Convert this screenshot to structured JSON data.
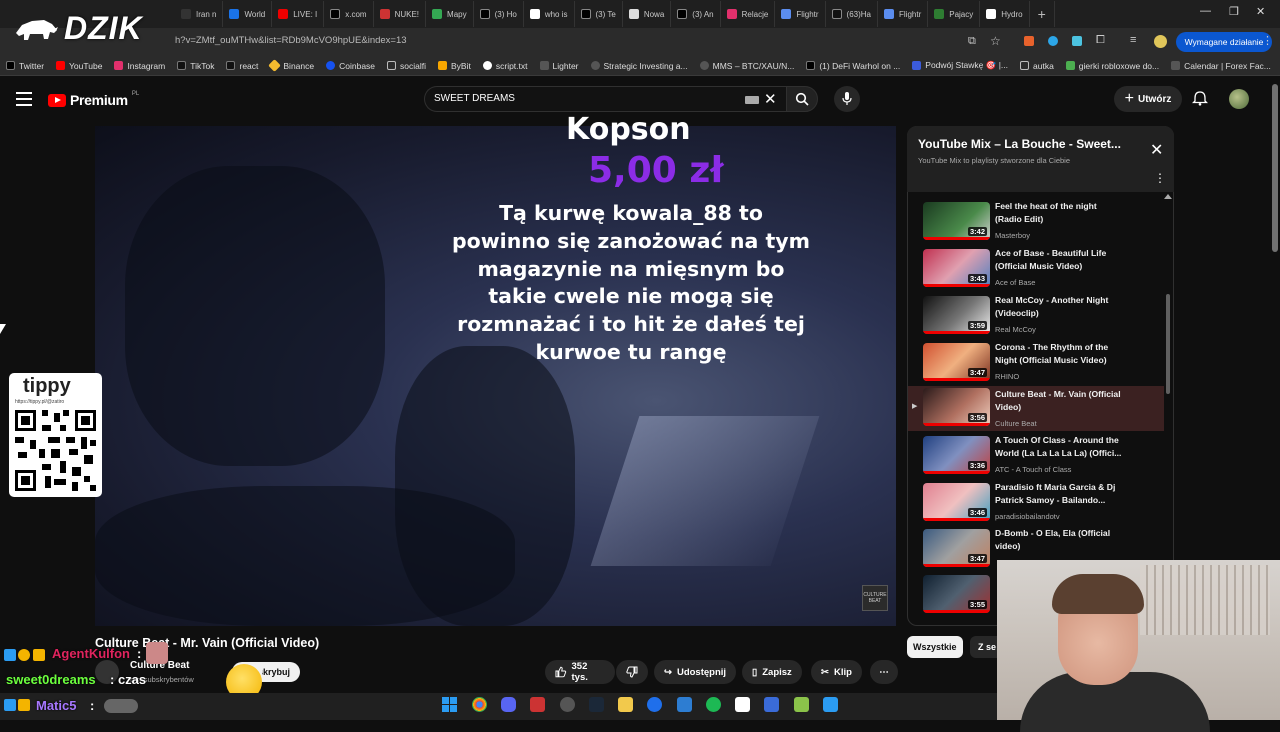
{
  "browser": {
    "tabs": [
      "Iran n",
      "World",
      "LIVE: I",
      "x.com",
      "NUKE!",
      "Mapy",
      "(3) Ho",
      "who is",
      "(3) Te",
      "Nowa",
      "(3) An",
      "Relacje",
      "Flightr",
      "(63)Ha",
      "Flightr",
      "Pajacy",
      "Hydro"
    ],
    "url": "h?v=ZMtf_ouMTHw&list=RDb9McVO9hpUE&index=13",
    "required_action": "Wymagane działanie",
    "bookmarks": [
      "Twitter",
      "YouTube",
      "Instagram",
      "TikTok",
      "react",
      "Binance",
      "Coinbase",
      "socialfi",
      "ByBit",
      "script.txt",
      "Lighter",
      "Strategic Investing a...",
      "MMS – BTC/XAU/N...",
      "(1) DeFi Warhol on ...",
      "Podwój Stawkę 🎯 |...",
      "autka",
      "gierki robloxowe do...",
      "Calendar | Forex Fac..."
    ]
  },
  "overlay": {
    "logo": "DZIK",
    "donation": {
      "name": "Kopson",
      "amount": "5,00 zł",
      "message": "Tą kurwę kowala_88 to powinno się zanożować na tym magazynie na mięsnym bo takie cwele nie mogą się rozmnażać i to hit że dałeś tej kurwoe tu rangę"
    },
    "tippy": {
      "title": "tippy",
      "url": "https://tippy.pl/@zatiro"
    },
    "chat": [
      {
        "name": "AgentKulfon",
        "text": ":",
        "color": "#e0245e"
      },
      {
        "name": "sweet0dreams",
        "text": ": czas",
        "color": "#6cff3e"
      },
      {
        "name": "Matic5",
        "text": ":",
        "color": "#a777ff"
      }
    ],
    "emote_count": "15"
  },
  "youtube": {
    "brand": "Premium",
    "country": "PL",
    "search_query": "SWEET DREAMS",
    "create_label": "Utwórz",
    "video": {
      "title": "Culture Beat - Mr. Vain (Official Video)",
      "channel": "Culture Beat",
      "subs": "tys. subskrybentów",
      "subscribe": "Subskrybuj",
      "likes": "352 tys.",
      "share": "Udostępnij",
      "save": "Zapisz",
      "clip": "Klip"
    },
    "playlist": {
      "title": "YouTube Mix – La Bouche - Sweet...",
      "subtitle": "YouTube Mix to playlisty stworzone dla Ciebie",
      "items": [
        {
          "title": "Feel the heat of the night (Radio Edit)",
          "channel": "Masterboy",
          "duration": "3:42"
        },
        {
          "title": "Ace of Base - Beautiful Life (Official Music Video)",
          "channel": "Ace of Base",
          "duration": "3:43"
        },
        {
          "title": "Real McCoy - Another Night (Videoclip)",
          "channel": "Real McCoy",
          "duration": "3:59"
        },
        {
          "title": "Corona - The Rhythm of the Night (Official Music Video)",
          "channel": "RHINO",
          "duration": "3:47"
        },
        {
          "title": "Culture Beat - Mr. Vain (Official Video)",
          "channel": "Culture Beat",
          "duration": "3:56"
        },
        {
          "title": "A Touch Of Class - Around the World (La La La La La) (Offici...",
          "channel": "ATC - A Touch of Class",
          "duration": "3:36"
        },
        {
          "title": "Paradisio ft Maria Garcia & Dj Patrick Samoy - Bailando...",
          "channel": "paradisiobailandotv",
          "duration": "3:46"
        },
        {
          "title": "D-Bomb - O Ela, Ela (Official video)",
          "channel": "",
          "duration": "3:47"
        },
        {
          "title": "",
          "channel": "",
          "duration": "3:55"
        }
      ]
    },
    "chips": [
      "Wszystkie",
      "Z se"
    ]
  }
}
